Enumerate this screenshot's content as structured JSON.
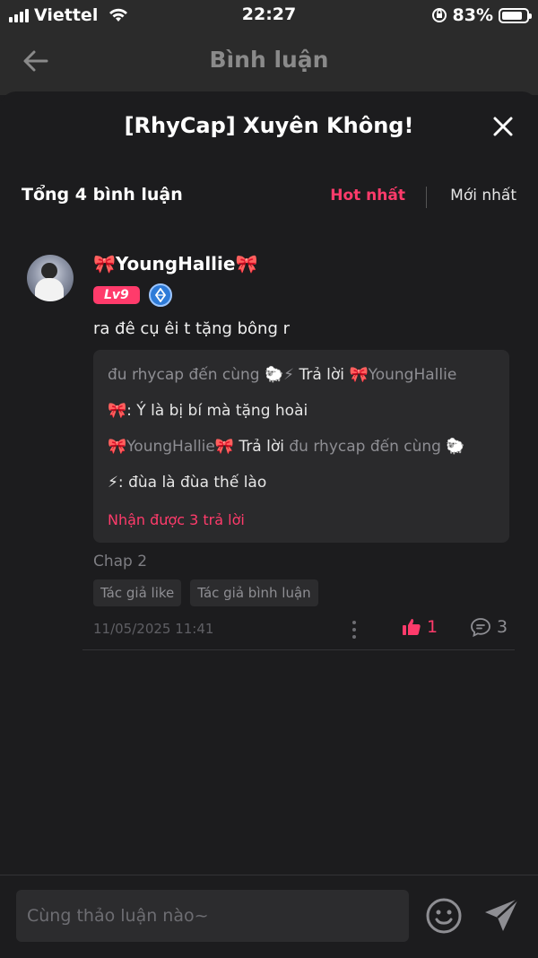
{
  "status_bar": {
    "carrier": "Viettel",
    "time": "22:27",
    "battery": "83%",
    "battery_level": 0.83
  },
  "header": {
    "title": "Bình luận",
    "back_icon": "arrow-left-icon"
  },
  "sheet": {
    "title": "[RhyCap] Xuyên Không!",
    "close_icon": "close-icon",
    "count_label": "Tổng 4 bình luận",
    "sort_options": [
      {
        "label": "Hot nhất",
        "active": true
      },
      {
        "label": "Mới nhất",
        "active": false
      }
    ]
  },
  "comment": {
    "username": "🎀YoungHallie🎀",
    "level": "Lv9",
    "comment_text": "ra đê cụ êi t tặng bông r",
    "replies": [
      {
        "author": "đu rhycap đến cùng 🐑⚡",
        "reply_word": " Trả lời ",
        "target": "🎀YoungHallie"
      },
      {
        "text": "🎀: Ý là bị bí mà tặng hoài"
      },
      {
        "author": "🎀YoungHallie🎀",
        "reply_word": " Trả lời ",
        "target": "đu rhycap đến cùng 🐑"
      },
      {
        "text": "⚡: đùa là đùa thế lào"
      }
    ],
    "more_replies": "Nhận được 3 trả lời",
    "chapter": "Chap 2",
    "tags": [
      "Tác giả like",
      "Tác giả bình luận"
    ],
    "timestamp": "11/05/2025 11:41",
    "likes": "1",
    "reply_count": "3"
  },
  "input": {
    "placeholder": "Cùng thảo luận nào~"
  },
  "colors": {
    "accent": "#ff3b6b",
    "background": "#1c1c1e",
    "header_bg": "#2b2b2b",
    "reply_bg": "#2a2a2c"
  }
}
